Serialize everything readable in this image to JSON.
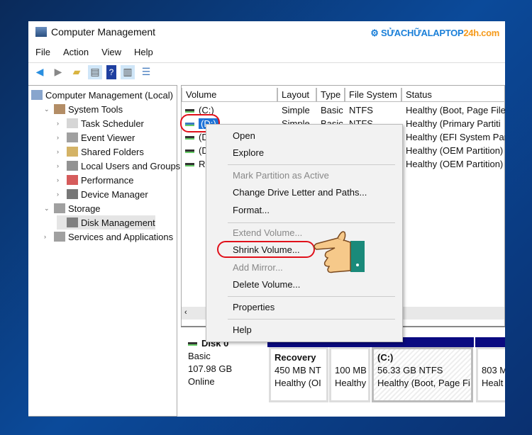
{
  "window": {
    "title": "Computer Management",
    "watermark": {
      "main": "SỬACHỮALAPTOP",
      "accent": "24h.com"
    }
  },
  "menu": [
    "File",
    "Action",
    "View",
    "Help"
  ],
  "toolbar": [
    "back-icon",
    "forward-icon",
    "up-folder-icon",
    "show-hide-tree-icon",
    "help-icon",
    "action-pane-icon",
    "properties-icon"
  ],
  "tree": [
    {
      "label": "Computer Management (Local)",
      "level": 0
    },
    {
      "label": "System Tools",
      "level": 1,
      "expanded": true
    },
    {
      "label": "Task Scheduler",
      "level": 2
    },
    {
      "label": "Event Viewer",
      "level": 2
    },
    {
      "label": "Shared Folders",
      "level": 2
    },
    {
      "label": "Local Users and Groups",
      "level": 2
    },
    {
      "label": "Performance",
      "level": 2
    },
    {
      "label": "Device Manager",
      "level": 2
    },
    {
      "label": "Storage",
      "level": 1,
      "expanded": true
    },
    {
      "label": "Disk Management",
      "level": 2,
      "selected": true
    },
    {
      "label": "Services and Applications",
      "level": 1
    }
  ],
  "columns": [
    "Volume",
    "Layout",
    "Type",
    "File System",
    "Status"
  ],
  "volumes": [
    {
      "volume": "(C:)",
      "layout": "Simple",
      "type": "Basic",
      "fs": "NTFS",
      "status": "Healthy (Boot, Page File"
    },
    {
      "volume": "(D:)",
      "layout": "Simple",
      "type": "Basic",
      "fs": "NTFS",
      "status": "Healthy (Primary Partiti"
    },
    {
      "volume": "(D",
      "layout": "",
      "type": "",
      "fs": "",
      "status": "Healthy (EFI System Par"
    },
    {
      "volume": "(D",
      "layout": "",
      "type": "",
      "fs": "",
      "status": "Healthy (OEM Partition)"
    },
    {
      "volume": "Re",
      "layout": "",
      "type": "",
      "fs": "",
      "status": "Healthy (OEM Partition)"
    }
  ],
  "context_menu": [
    {
      "label": "Open",
      "enabled": true
    },
    {
      "label": "Explore",
      "enabled": true
    },
    {
      "label": "Mark Partition as Active",
      "enabled": false
    },
    {
      "label": "Change Drive Letter and Paths...",
      "enabled": true
    },
    {
      "label": "Format...",
      "enabled": true
    },
    {
      "label": "Extend Volume...",
      "enabled": false
    },
    {
      "label": "Shrink Volume...",
      "enabled": true,
      "highlighted": true
    },
    {
      "label": "Add Mirror...",
      "enabled": false
    },
    {
      "label": "Delete Volume...",
      "enabled": true
    },
    {
      "label": "Properties",
      "enabled": true
    },
    {
      "label": "Help",
      "enabled": true
    }
  ],
  "disk": {
    "name": "Disk 0",
    "type": "Basic",
    "size": "107.98 GB",
    "state": "Online",
    "partitions": [
      {
        "name": "Recovery",
        "size": "450 MB NT",
        "status": "Healthy (OI"
      },
      {
        "name": "",
        "size": "100 MB",
        "status": "Healthy"
      },
      {
        "name": "(C:)",
        "size": "56.33 GB NTFS",
        "status": "Healthy (Boot, Page Fi"
      },
      {
        "name": "",
        "size": "803 M",
        "status": "Healt"
      }
    ]
  },
  "colors": {
    "highlight_circle": "#e0101a",
    "selection": "#1e73d8",
    "disk_bar": "#0a0a80"
  }
}
